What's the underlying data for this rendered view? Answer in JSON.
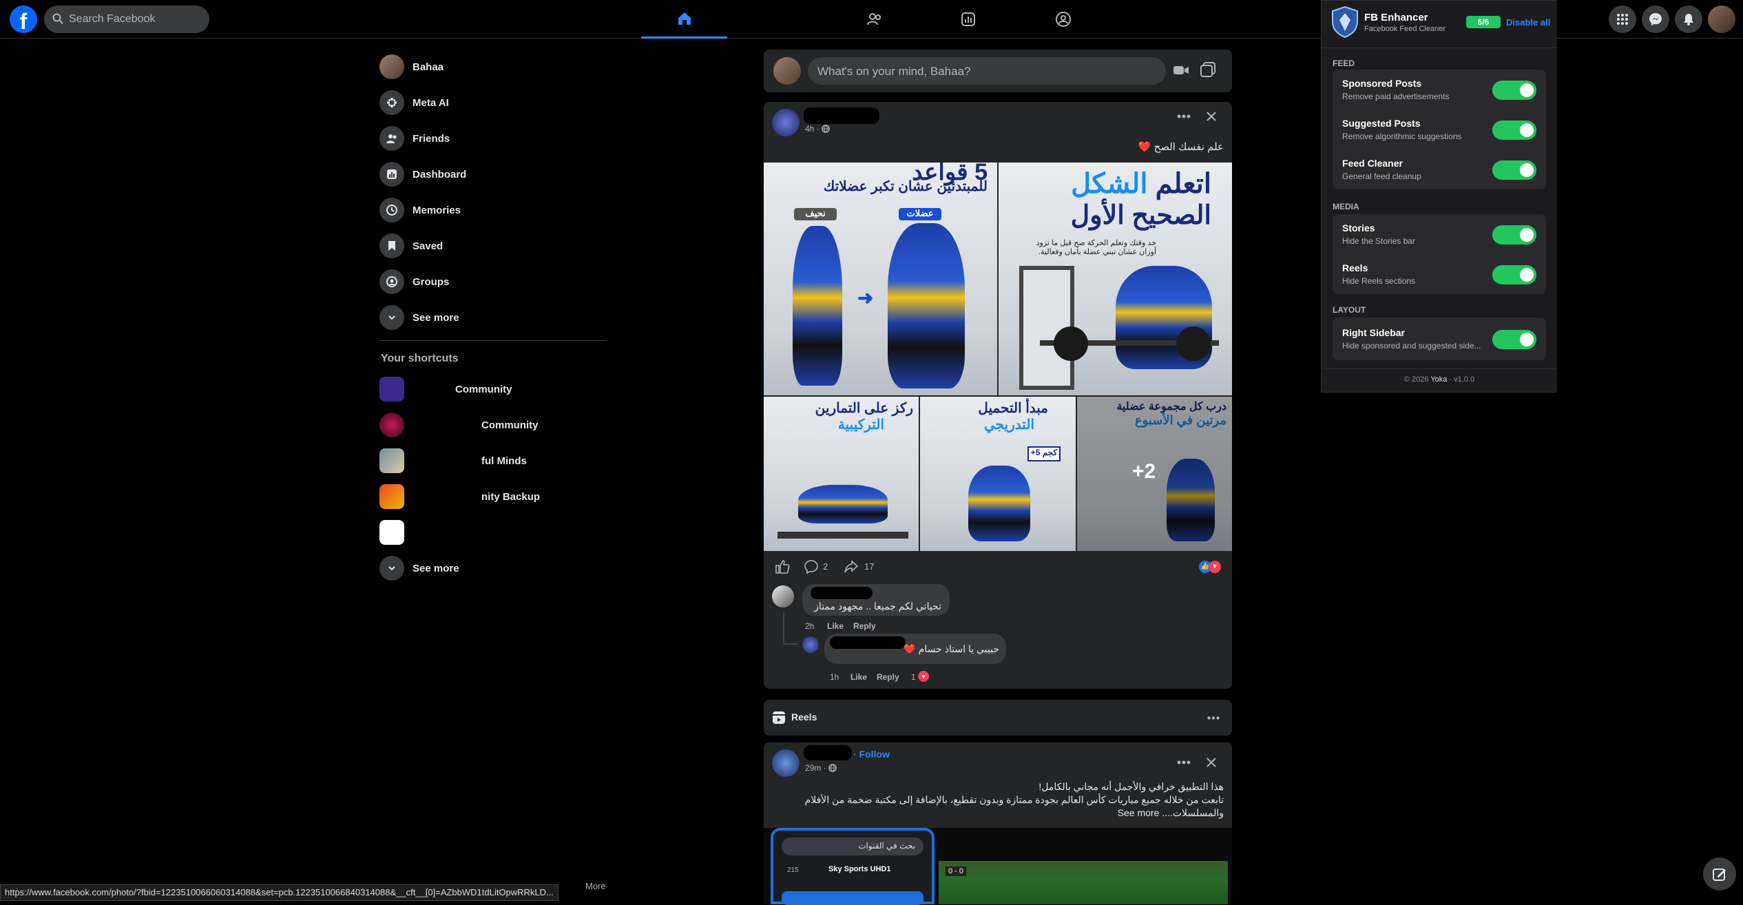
{
  "topbar": {
    "search_placeholder": "Search Facebook"
  },
  "sidebar": {
    "profile_name": "Bahaa",
    "items": [
      {
        "label": "Meta AI"
      },
      {
        "label": "Friends"
      },
      {
        "label": "Dashboard"
      },
      {
        "label": "Memories"
      },
      {
        "label": "Saved"
      },
      {
        "label": "Groups"
      },
      {
        "label": "See more"
      }
    ],
    "shortcuts_title": "Your shortcuts",
    "shortcuts": [
      {
        "label": "Community"
      },
      {
        "label": "Community"
      },
      {
        "label": "ful Minds"
      },
      {
        "label": "nity Backup"
      },
      {
        "label": ""
      }
    ],
    "shortcuts_see_more": "See more"
  },
  "composer": {
    "placeholder": "What's on your mind, Bahaa?"
  },
  "post1": {
    "time": "4h · ",
    "caption": "علم نفسك الصح ❤️",
    "images": {
      "img1_title": "5 قواعد",
      "img1_sub": "للمبتدئين عشان تكبر عضلاتك",
      "img1_left_tag": "نحيف",
      "img1_right_tag": "عضلات",
      "img2_title_a": "اتعلم",
      "img2_title_b": "الشكل",
      "img2_title_c": "الصحيح الأول",
      "img2_body": "خد وقتك وتعلم الحركة صح قبل ما تزود أوزان عشان تبني عضلة بأمان وفعالية.",
      "img3_title_a": "ركز على التمارين",
      "img3_title_b": "التركيبية",
      "img4_title_a": "مبدأ التحميل",
      "img4_title_b": "التدريجي",
      "img4_badge": "+5 كجم",
      "img5_title_a": "درب كل مجموعة عضلية",
      "img5_title_b": "مرتين في الأسبوع",
      "more_count": "+2"
    },
    "comments_count": "2",
    "shares_count": "17",
    "comment1": {
      "text": "تحياتي لكم جميعا .. مجهود ممتاز",
      "time": "2h",
      "like": "Like",
      "reply": "Reply"
    },
    "comment2": {
      "text": "حبيبي يا استاذ حسام ❤️",
      "time": "1h",
      "like": "Like",
      "reply": "Reply",
      "reactions": "1"
    }
  },
  "reels": {
    "label": "Reels"
  },
  "post2": {
    "follow": "· Follow",
    "time": "29m · ",
    "line1": "هذا التطبيق خرافي والأجمل أنه مجاني بالكامل!",
    "line2": "تابعت من خلاله جميع مباريات كأس العالم بجودة ممتازة وبدون تقطيع، بالإضافة إلى مكتبة ضخمة من الأفلام",
    "line3": "والمسلسلات.... See more",
    "app_search": "بحث في القنوات",
    "channel_num": "215",
    "channel_name": "Sky Sports UHD1",
    "score": "0 - 0"
  },
  "extension": {
    "title": "FB Enhancer",
    "subtitle": "Facebook Feed Cleaner",
    "count": "6/6",
    "disable_all": "Disable all",
    "sections": {
      "feed": "FEED",
      "media": "MEDIA",
      "layout": "LAYOUT"
    },
    "rows": [
      {
        "title": "Sponsored Posts",
        "sub": "Remove paid advertisements",
        "on": true
      },
      {
        "title": "Suggested Posts",
        "sub": "Remove algorithmic suggestions",
        "on": true
      },
      {
        "title": "Feed Cleaner",
        "sub": "General feed cleanup",
        "on": true
      },
      {
        "title": "Stories",
        "sub": "Hide the Stories bar",
        "on": true
      },
      {
        "title": "Reels",
        "sub": "Hide Reels sections",
        "on": true
      },
      {
        "title": "Right Sidebar",
        "sub": "Hide sponsored and suggested side...",
        "on": true
      }
    ],
    "footer_a": "© 2026 ",
    "footer_b": "Yoka",
    "footer_c": " · v1.0.0",
    "accent": "#22c55e",
    "link_color": "#2d88ff"
  },
  "status_url": "https://www.facebook.com/photo/?fbid=1223510066060314088&set=pcb.1223510066840314088&__cft__[0]=AZbbWD1tdLitOpwRRkLD...",
  "footer_more": "More"
}
